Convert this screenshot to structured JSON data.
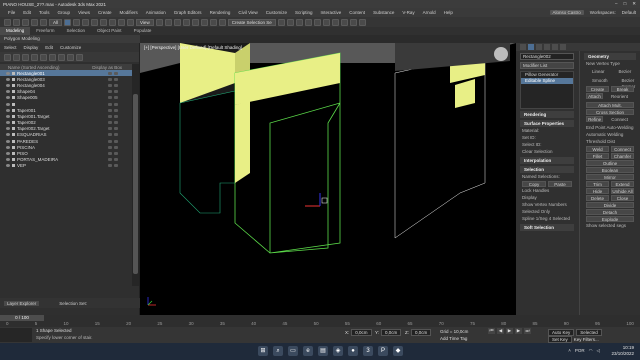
{
  "window": {
    "title": "PIANO HOUSE_2??.max - Autodesk 3ds Max 2021",
    "controls": [
      "–",
      "□",
      "✕"
    ]
  },
  "menu": {
    "items": [
      "File",
      "Edit",
      "Tools",
      "Group",
      "Views",
      "Create",
      "Modifiers",
      "Animation",
      "Graph Editors",
      "Rendering",
      "Civil View",
      "Customize",
      "Scripting",
      "Interactive",
      "Content",
      "Substance",
      "V-Ray",
      "Arnold",
      "Help"
    ],
    "user": "Alonso Castro",
    "workspaces_label": "Workspaces:",
    "workspace_value": "Default"
  },
  "toolbar": {
    "selection_set_placeholder": "Create Selection Se",
    "view_dropdown": "View"
  },
  "ribbon": {
    "tabs": [
      "Modeling",
      "Freeform",
      "Selection",
      "Object Paint",
      "Populate"
    ],
    "active_tab": "Modeling",
    "sub_label": "Polygon Modeling"
  },
  "scene_explorer": {
    "menu": [
      "Select",
      "Display",
      "Edit",
      "Customize"
    ],
    "col_name": "Name (Sorted Ascending)",
    "col_right": "Frozen",
    "col_right2": "Display as Box",
    "rows": [
      {
        "name": "Rectangle001",
        "selected": true
      },
      {
        "name": "Rectangle003",
        "selected": false
      },
      {
        "name": "Rectangle004",
        "selected": false
      },
      {
        "name": "Shape04",
        "selected": false
      },
      {
        "name": "Shape005",
        "selected": false
      },
      {
        "name": "",
        "selected": false
      },
      {
        "name": "Taper001",
        "selected": false
      },
      {
        "name": "Taper001.Target",
        "selected": false
      },
      {
        "name": "Taper002",
        "selected": false
      },
      {
        "name": "Taper002.Target",
        "selected": false
      },
      {
        "name": "ESQUADRIAS",
        "selected": false
      },
      {
        "name": "PAREDES",
        "selected": false
      },
      {
        "name": "PISCINA",
        "selected": false
      },
      {
        "name": "PISO",
        "selected": false
      },
      {
        "name": "PORTAS_MADEIRA",
        "selected": false
      },
      {
        "name": "VEP",
        "selected": false
      }
    ],
    "footer_left": "Layer Explorer",
    "footer_right": "Selection Set:"
  },
  "viewport": {
    "label": "[+] [Perspective] [User Defined] [Default Shading]"
  },
  "command_panel": {
    "object_name": "Rectangle002",
    "modifier_list": "Modifier List",
    "stack": [
      "Pillow Generator",
      "Editable Spline"
    ],
    "rollouts": {
      "rendering": "Rendering",
      "surface": "Surface Properties",
      "interpolation": "Interpolation",
      "selection": "Selection",
      "soft_selection": "Soft Selection",
      "geometry": "Geometry"
    },
    "material_label": "Material:",
    "set_id_label": "Set ID:",
    "select_id_label": "Select ID:",
    "clear_selection": "Clear Selection",
    "named_selections": "Named Selections:",
    "copy": "Copy",
    "paste": "Paste",
    "lock_handles": "Lock Handles",
    "show_vertex_numbers": "Show Vertex Numbers",
    "selected_only": "Selected Only",
    "spline_status": "Spline 1/Seg 4 Selected",
    "display_label": "Display",
    "geometry": {
      "new_vertex_type": "New Vertex Type",
      "linear": "Linear",
      "bezier": "Bezier",
      "smooth": "Smooth",
      "bezier_corner": "Bezier Corner",
      "create_line": "Create Line",
      "break": "Break",
      "attach": "Attach",
      "reorient": "Reorient",
      "attach_mult": "Attach Mult.",
      "cross_section": "Cross Section",
      "refine": "Refine",
      "connect": "Connect",
      "end_point_auto": "End Point Auto-Welding",
      "auto_welding": "Automatic Welding",
      "threshold": "Threshold Dist",
      "weld": "Weld",
      "connect_copy": "Connect Copy",
      "fillet": "Fillet",
      "chamfer": "Chamfer",
      "outline": "Outline",
      "boolean": "Boolean",
      "mirror": "Mirror",
      "trim": "Trim",
      "extend": "Extend",
      "hide": "Hide",
      "unhide_all": "Unhide All",
      "delete": "Delete",
      "close": "Close",
      "divide": "Divide",
      "detach": "Detach",
      "explode": "Explode",
      "show_selected": "Show selected segs"
    }
  },
  "timeline": {
    "slider": "0 / 100",
    "ticks": [
      "0",
      "5",
      "10",
      "15",
      "20",
      "25",
      "30",
      "35",
      "40",
      "45",
      "50",
      "55",
      "60",
      "65",
      "70",
      "75",
      "80",
      "85",
      "90",
      "95",
      "100"
    ]
  },
  "status": {
    "line1": "1 Shape Selected",
    "line2": "Specify lower corner of stair.",
    "x_label": "X:",
    "x_value": "0,0cm",
    "y_label": "Y:",
    "y_value": "0,0cm",
    "z_label": "Z:",
    "z_value": "0,0cm",
    "grid": "Grid = 10,0cm",
    "add_time_tag": "Add Time Tag",
    "auto_key": "Auto Key",
    "selected": "Selected",
    "set_key": "Set Key",
    "key_filters": "Key Filters..."
  },
  "taskbar": {
    "time": "10:19",
    "date": "23/10/2022",
    "lang": "POR"
  }
}
